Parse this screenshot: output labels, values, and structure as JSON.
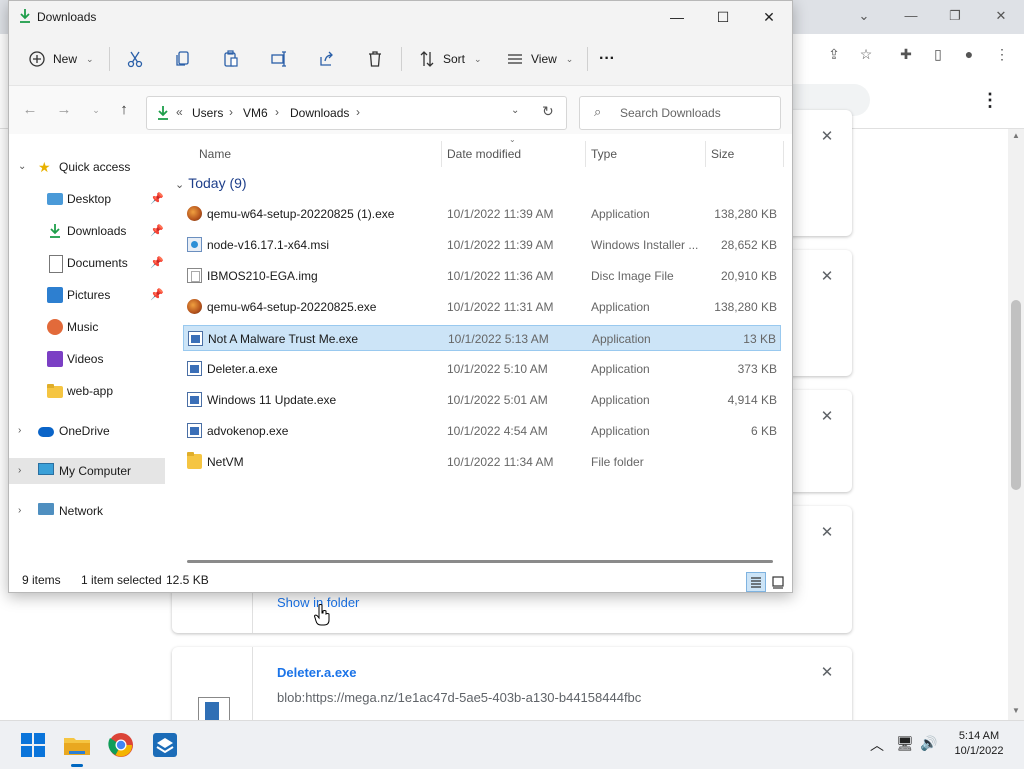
{
  "explorer": {
    "title": "Downloads",
    "commands": {
      "new": "New",
      "sort": "Sort",
      "view": "View",
      "more": "···"
    },
    "breadcrumb": [
      "Users",
      "VM6",
      "Downloads"
    ],
    "search_placeholder": "Search Downloads",
    "nav": {
      "quick_access": "Quick access",
      "quick_items": [
        "Desktop",
        "Downloads",
        "Documents",
        "Pictures",
        "Music",
        "Videos",
        "web-app"
      ],
      "onedrive": "OneDrive",
      "my_computer": "My Computer",
      "network": "Network"
    },
    "columns": {
      "name": "Name",
      "date": "Date modified",
      "type": "Type",
      "size": "Size"
    },
    "group": "Today (9)",
    "files": [
      {
        "name": "qemu-w64-setup-20220825 (1).exe",
        "date": "10/1/2022 11:39 AM",
        "type": "Application",
        "size": "138,280 KB",
        "icon": "qemu-icon"
      },
      {
        "name": "node-v16.17.1-x64.msi",
        "date": "10/1/2022 11:39 AM",
        "type": "Windows Installer ...",
        "size": "28,652 KB",
        "icon": "msi-icon"
      },
      {
        "name": "IBMOS210-EGA.img",
        "date": "10/1/2022 11:36 AM",
        "type": "Disc Image File",
        "size": "20,910 KB",
        "icon": "disc-image-icon"
      },
      {
        "name": "qemu-w64-setup-20220825.exe",
        "date": "10/1/2022 11:31 AM",
        "type": "Application",
        "size": "138,280 KB",
        "icon": "qemu-icon"
      },
      {
        "name": "Not A Malware Trust Me.exe",
        "date": "10/1/2022 5:13 AM",
        "type": "Application",
        "size": "13 KB",
        "icon": "exe-icon",
        "selected": true
      },
      {
        "name": "Deleter.a.exe",
        "date": "10/1/2022 5:10 AM",
        "type": "Application",
        "size": "373 KB",
        "icon": "exe-icon"
      },
      {
        "name": "Windows 11 Update.exe",
        "date": "10/1/2022 5:01 AM",
        "type": "Application",
        "size": "4,914 KB",
        "icon": "exe-icon"
      },
      {
        "name": "advokenop.exe",
        "date": "10/1/2022 4:54 AM",
        "type": "Application",
        "size": "6 KB",
        "icon": "exe-icon"
      },
      {
        "name": "NetVM",
        "date": "10/1/2022 11:34 AM",
        "type": "File folder",
        "size": "",
        "icon": "folder-icon"
      }
    ],
    "status": {
      "items": "9 items",
      "selected": "1 item selected",
      "size": "12.5 KB"
    }
  },
  "chrome": {
    "show_in_folder": "Show in folder",
    "download_name": "Deleter.a.exe",
    "download_url": "blob:https://mega.nz/1e1ac47d-5ae5-403b-a130-b44158444fbc"
  },
  "taskbar": {
    "time": "5:14 AM",
    "date": "10/1/2022"
  },
  "colors": {
    "selection": "#cce4f7",
    "selection_border": "#99c9ef",
    "accent": "#0067c0",
    "link": "#1a73e8"
  }
}
